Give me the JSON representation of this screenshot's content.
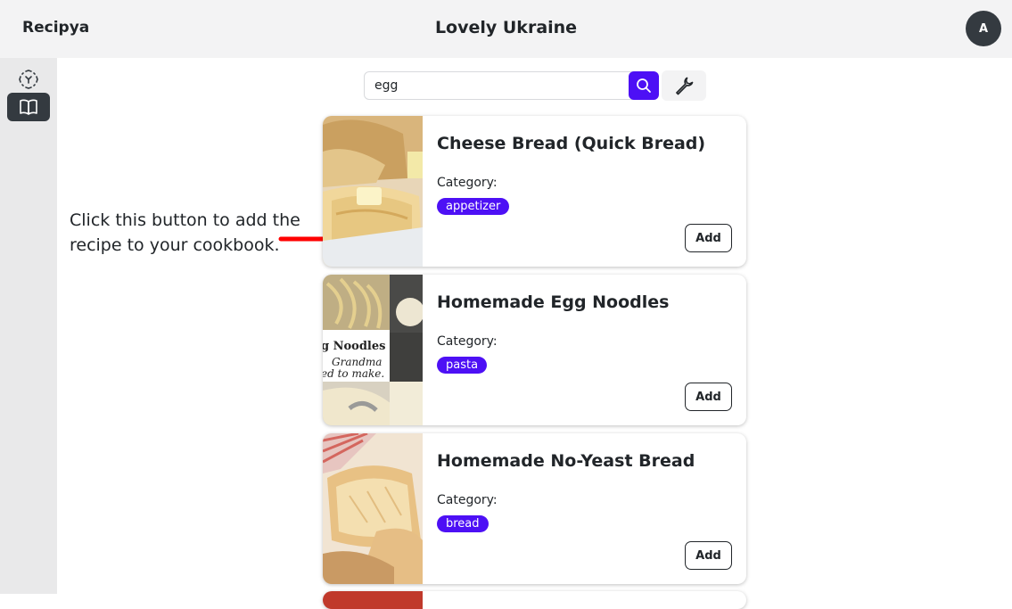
{
  "app": {
    "brand": "Recipya",
    "page_title": "Lovely Ukraine",
    "avatar_initial": "A"
  },
  "sidebar": {
    "items": [
      {
        "icon": "scan-icon",
        "active": false
      },
      {
        "icon": "book-open-icon",
        "active": true
      }
    ]
  },
  "search": {
    "value": "egg",
    "placeholder": ""
  },
  "hint": {
    "text": "Click this button to add the recipe to your cookbook."
  },
  "recipes": [
    {
      "title": "Cheese Bread (Quick Bread)",
      "category_label": "Category:",
      "category": "appetizer",
      "add_label": "Add"
    },
    {
      "title": "Homemade Egg Noodles",
      "category_label": "Category:",
      "category": "pasta",
      "add_label": "Add",
      "image_text": [
        "g Noodles",
        "Grandma",
        "ed to make."
      ]
    },
    {
      "title": "Homemade No-Yeast Bread",
      "category_label": "Category:",
      "category": "bread",
      "add_label": "Add"
    }
  ],
  "colors": {
    "accent": "#4d10f5",
    "annotation_arrow": "#ff0000",
    "dark": "#343a40"
  }
}
